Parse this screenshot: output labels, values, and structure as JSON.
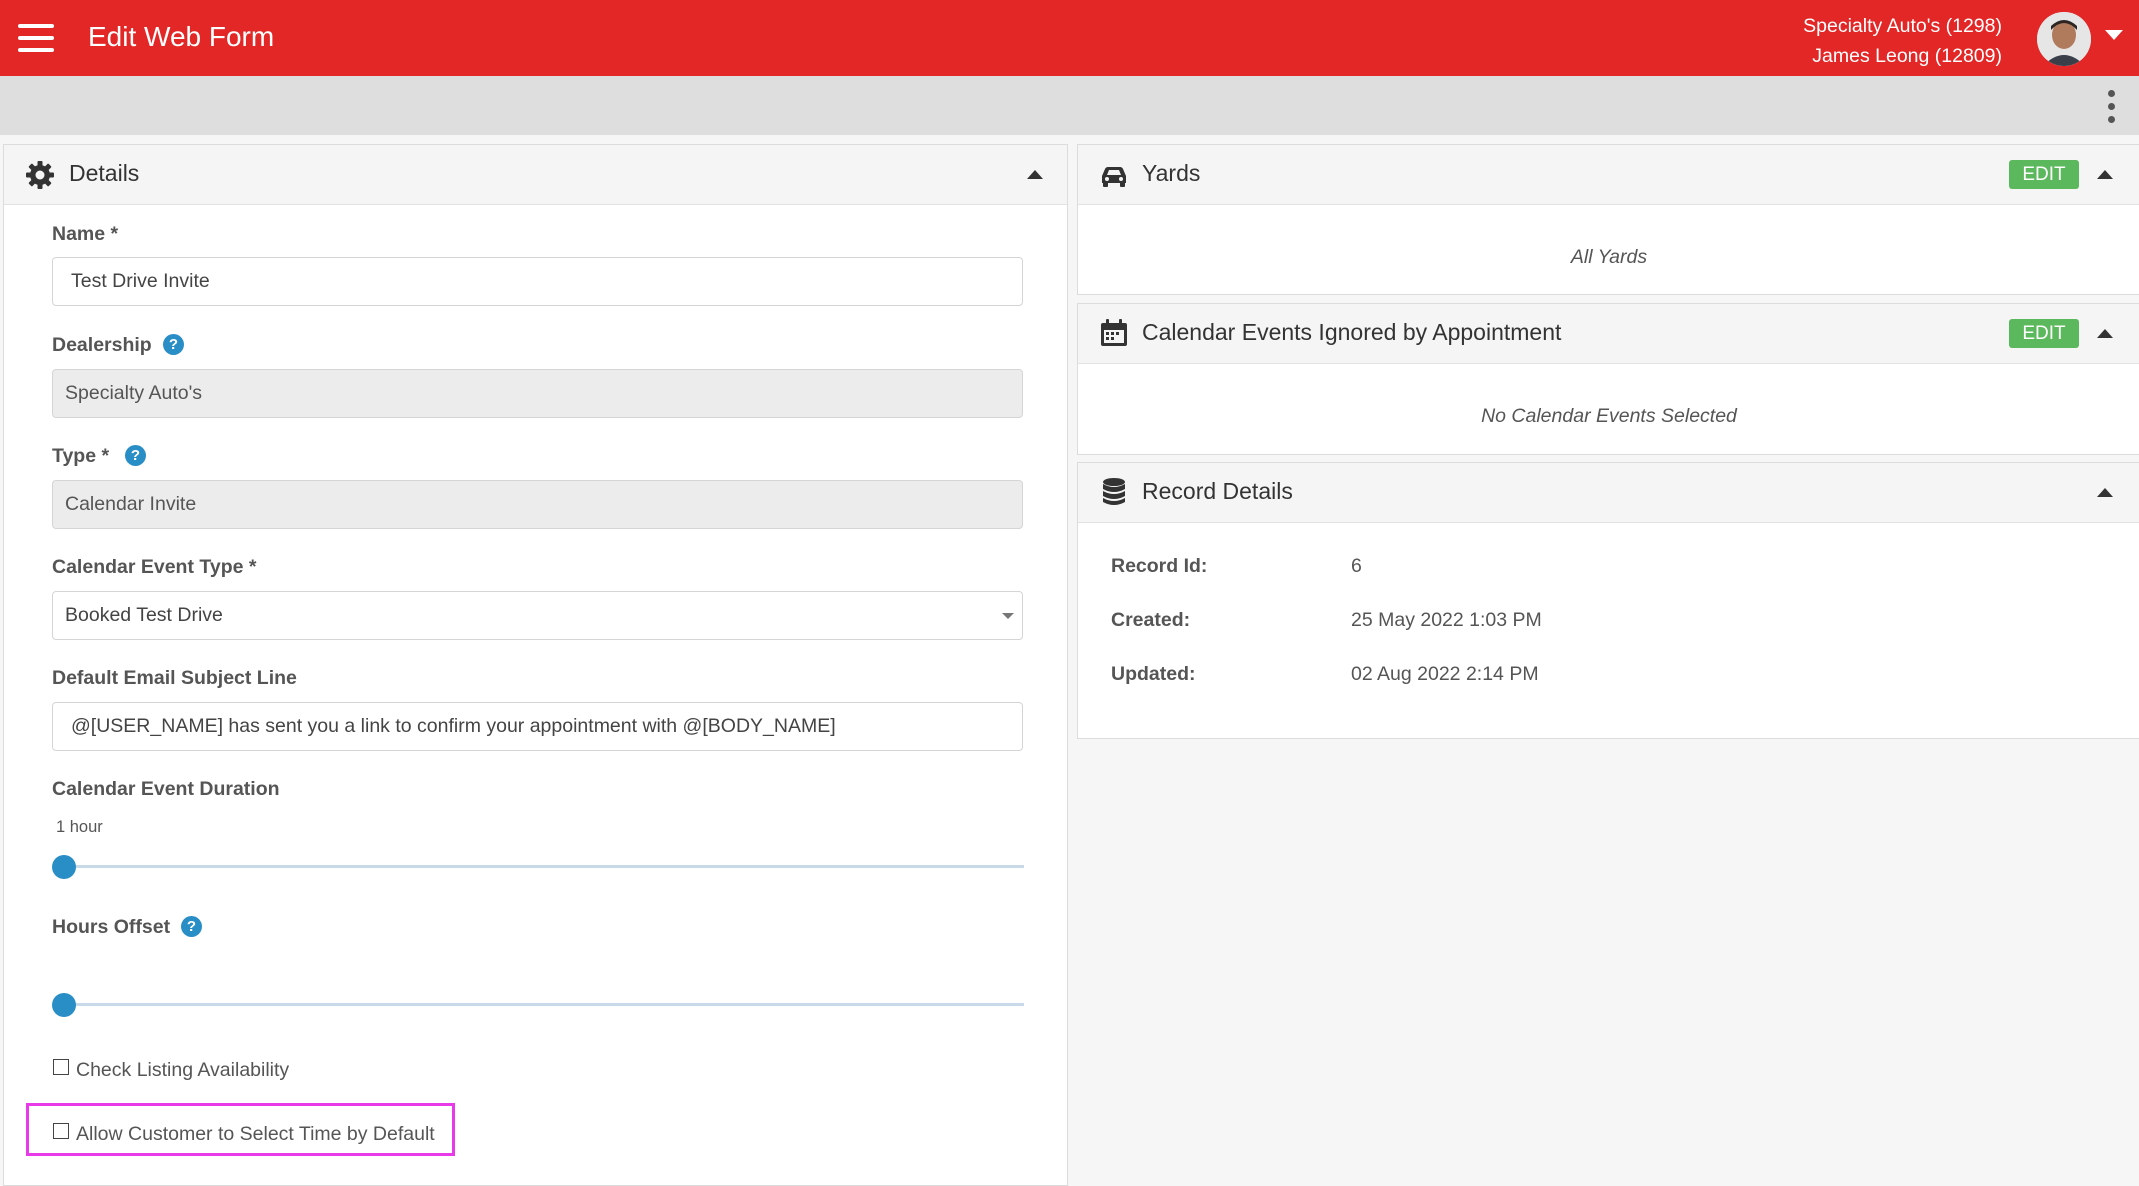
{
  "app": {
    "title": "Edit Web Form"
  },
  "account": {
    "dealership": "Specialty Auto's (1298)",
    "user": "James Leong (12809)"
  },
  "details": {
    "title": "Details",
    "name_label": "Name *",
    "name_value": "Test Drive Invite",
    "dealership_label": "Dealership",
    "dealership_value": "Specialty Auto's",
    "type_label": "Type *",
    "type_value": "Calendar Invite",
    "event_type_label": "Calendar Event Type *",
    "event_type_value": "Booked Test Drive",
    "subject_label": "Default Email Subject Line",
    "subject_value": "@[USER_NAME] has sent you a link to confirm your appointment with @[BODY_NAME]",
    "duration_label": "Calendar Event Duration",
    "duration_value": "1 hour",
    "duration_slider_fraction": 0,
    "offset_label": "Hours Offset",
    "offset_slider_fraction": 0,
    "check_listing_label": "Check Listing Availability",
    "check_listing_checked": false,
    "allow_select_time_label": "Allow Customer to Select Time by Default",
    "allow_select_time_checked": false,
    "help_symbol": "?"
  },
  "yards": {
    "title": "Yards",
    "edit_label": "EDIT",
    "empty_text": "All Yards"
  },
  "calendar_events": {
    "title": "Calendar Events Ignored by Appointment",
    "edit_label": "EDIT",
    "empty_text": "No Calendar Events Selected"
  },
  "record_details": {
    "title": "Record Details",
    "record_id_label": "Record Id:",
    "record_id_value": "6",
    "created_label": "Created:",
    "created_value": "25 May 2022 1:03 PM",
    "updated_label": "Updated:",
    "updated_value": "02 Aug 2022 2:14 PM"
  },
  "colors": {
    "header_bg": "#e32626",
    "edit_button": "#5cb85c",
    "accent_blue": "#2a8ec6",
    "highlight_box": "#e83ae8"
  },
  "icons": [
    "menu-icon",
    "user-avatar",
    "chevron-down-icon",
    "kebab-menu-icon",
    "gear-icon",
    "car-icon",
    "calendar-icon",
    "database-icon",
    "chevron-up-icon",
    "help-icon"
  ]
}
